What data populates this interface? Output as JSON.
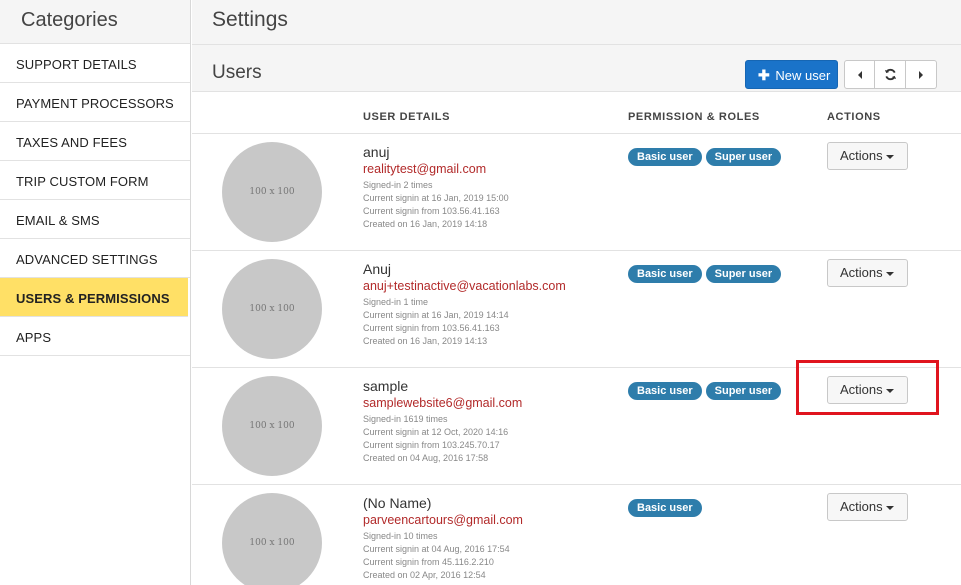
{
  "sidebar": {
    "title": "Categories",
    "items": [
      {
        "label": "SUPPORT DETAILS"
      },
      {
        "label": "PAYMENT PROCESSORS"
      },
      {
        "label": "TAXES AND FEES"
      },
      {
        "label": "TRIP CUSTOM FORM"
      },
      {
        "label": "EMAIL & SMS"
      },
      {
        "label": "ADVANCED SETTINGS"
      },
      {
        "label": "USERS & PERMISSIONS",
        "active": true
      },
      {
        "label": "APPS"
      }
    ]
  },
  "header": {
    "title": "Settings"
  },
  "panel": {
    "title": "Users",
    "new_user_label": "New user",
    "new_user_icon": "plus-icon",
    "nav_icons": [
      "caret-left-icon",
      "refresh-icon",
      "caret-right-icon"
    ]
  },
  "table": {
    "columns": {
      "user_details": "USER DETAILS",
      "permissions": "PERMISSION & ROLES",
      "actions": "ACTIONS"
    },
    "avatar_placeholder": "100 x 100",
    "actions_label": "Actions",
    "users": [
      {
        "name": "anuj",
        "email": "realitytest@gmail.com",
        "signins": "Signed-in 2 times",
        "current_signin_at": "Current signin at 16 Jan, 2019 15:00",
        "current_signin_from": "Current signin from 103.56.41.163",
        "created": "Created on 16 Jan, 2019 14:18",
        "roles": [
          "Basic user",
          "Super user"
        ]
      },
      {
        "name": "Anuj",
        "email": "anuj+testinactive@vacationlabs.com",
        "signins": "Signed-in 1 time",
        "current_signin_at": "Current signin at 16 Jan, 2019 14:14",
        "current_signin_from": "Current signin from 103.56.41.163",
        "created": "Created on 16 Jan, 2019 14:13",
        "roles": [
          "Basic user",
          "Super user"
        ]
      },
      {
        "name": "sample",
        "email": "samplewebsite6@gmail.com",
        "signins": "Signed-in 1619 times",
        "current_signin_at": "Current signin at 12 Oct, 2020 14:16",
        "current_signin_from": "Current signin from 103.245.70.17",
        "created": "Created on 04 Aug, 2016 17:58",
        "roles": [
          "Basic user",
          "Super user"
        ]
      },
      {
        "name": "(No Name)",
        "email": "parveencartours@gmail.com",
        "signins": "Signed-in 10 times",
        "current_signin_at": "Current signin at 04 Aug, 2016 17:54",
        "current_signin_from": "Current signin from 45.116.2.210",
        "created": "Created on 02 Apr, 2016 12:54",
        "roles": [
          "Basic user"
        ]
      }
    ]
  },
  "colors": {
    "active_item": "#ffe066",
    "primary": "#1a73c9",
    "badge": "#2e7dab",
    "email": "#b22a2a",
    "highlight": "#e0141e"
  }
}
